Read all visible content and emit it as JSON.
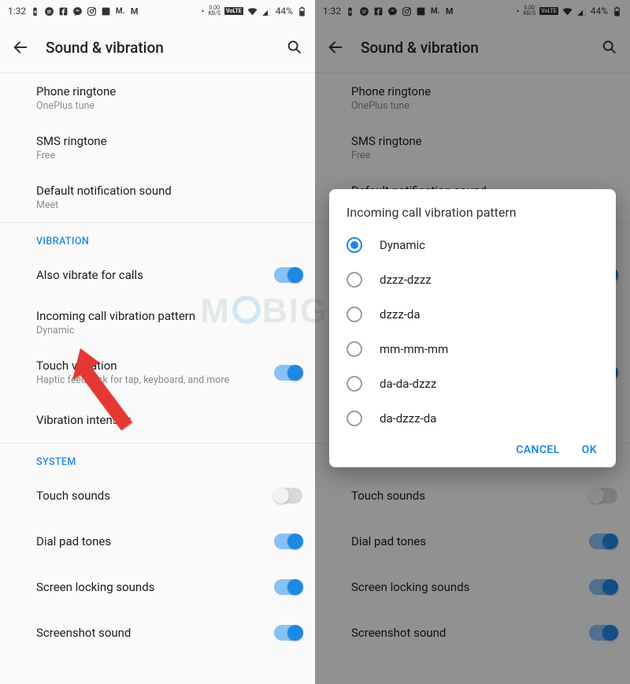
{
  "status": {
    "time": "1:32",
    "kbs_top": "0.00",
    "kbs_bot": "KB/S",
    "volte": "VoLTE",
    "battery": "44%"
  },
  "header": {
    "title": "Sound & vibration"
  },
  "settings": {
    "phone_ringtone": {
      "title": "Phone ringtone",
      "sub": "OnePlus tune"
    },
    "sms_ringtone": {
      "title": "SMS ringtone",
      "sub": "Free"
    },
    "default_notification": {
      "title": "Default notification sound",
      "sub": "Meet"
    },
    "vibration_header": "VIBRATION",
    "also_vibrate": {
      "title": "Also vibrate for calls"
    },
    "incoming_pattern": {
      "title": "Incoming call vibration pattern",
      "sub": "Dynamic"
    },
    "touch_vibration": {
      "title": "Touch vibration",
      "sub": "Haptic feedback for tap, keyboard, and more"
    },
    "vibration_intensity": {
      "title": "Vibration intensity"
    },
    "system_header": "SYSTEM",
    "touch_sounds": {
      "title": "Touch sounds"
    },
    "dial_pad": {
      "title": "Dial pad tones"
    },
    "screen_lock": {
      "title": "Screen locking sounds"
    },
    "screenshot": {
      "title": "Screenshot sound"
    }
  },
  "dialog": {
    "title": "Incoming call vibration pattern",
    "options": [
      "Dynamic",
      "dzzz-dzzz",
      "dzzz-da",
      "mm-mm-mm",
      "da-da-dzzz",
      "da-dzzz-da"
    ],
    "cancel": "CANCEL",
    "ok": "OK"
  },
  "watermark_prefix": "M",
  "watermark_suffix": "BIGYAAN"
}
